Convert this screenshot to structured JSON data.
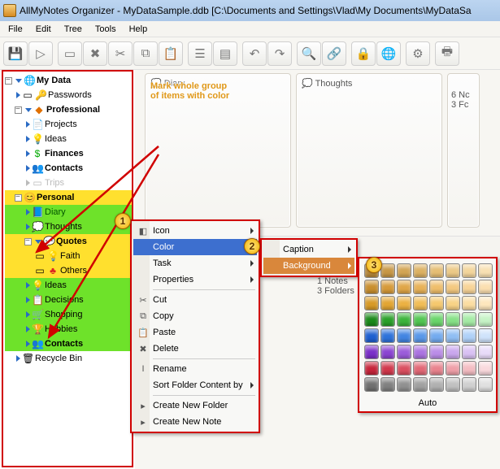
{
  "window": {
    "title": "AllMyNotes Organizer - MyDataSample.ddb [C:\\Documents and Settings\\Vlad\\My Documents\\MyDataSa"
  },
  "menu": {
    "items": [
      "File",
      "Edit",
      "Tree",
      "Tools",
      "Help"
    ]
  },
  "tree": {
    "root": "My Data",
    "passwords": "Passwords",
    "professional": "Professional",
    "projects": "Projects",
    "ideas": "Ideas",
    "finances": "Finances",
    "contacts": "Contacts",
    "trips": "Trips",
    "personal": "Personal",
    "diary": "Diary",
    "thoughts": "Thoughts",
    "quotes": "Quotes",
    "faith": "Faith",
    "others": "Others",
    "ideas2": "Ideas",
    "decisions": "Decisions",
    "shopping": "Shopping",
    "hobbies": "Hobbies",
    "contacts2": "Contacts",
    "recycle": "Recycle Bin"
  },
  "cards": {
    "diary": "Diary",
    "thoughts": "Thoughts",
    "side_line1": "6 Nc",
    "side_line2": "3 Fc"
  },
  "annotation": {
    "line1": "Mark whole group",
    "line2": "of items with color"
  },
  "context_menu": {
    "icon": "Icon",
    "color": "Color",
    "task": "Task",
    "properties": "Properties",
    "cut": "Cut",
    "copy": "Copy",
    "paste": "Paste",
    "delete": "Delete",
    "rename": "Rename",
    "sort": "Sort Folder Content by",
    "new_folder": "Create New Folder",
    "new_note": "Create New Note"
  },
  "color_submenu": {
    "caption": "Caption",
    "background": "Background"
  },
  "quotes_info": {
    "line1": "1 Notes",
    "line2": "3 Folders"
  },
  "palette": {
    "auto": "Auto"
  },
  "badges": {
    "b1": "1",
    "b2": "2",
    "b3": "3"
  }
}
